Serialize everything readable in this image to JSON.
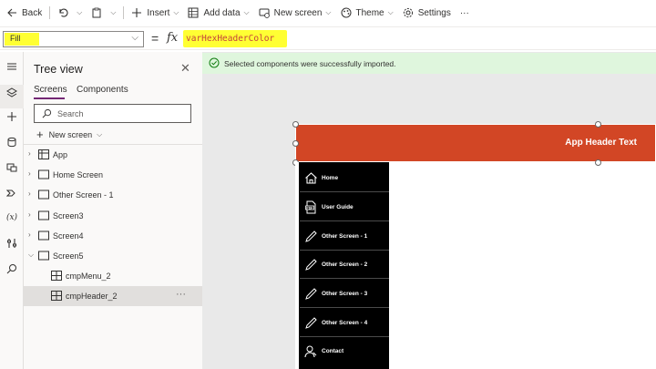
{
  "toolbar": {
    "back_label": "Back",
    "insert_label": "Insert",
    "add_data_label": "Add data",
    "new_screen_label": "New screen",
    "theme_label": "Theme",
    "settings_label": "Settings",
    "more_label": "···"
  },
  "formula_bar": {
    "property": "Fill",
    "equals": "=",
    "fx": "fx",
    "formula": "varHexHeaderColor",
    "highlight_color": "#ffff33"
  },
  "left_rail": {
    "icons": [
      "hamburger-icon",
      "layers-icon",
      "plus-icon",
      "database-icon",
      "media-icon",
      "power-automate-icon",
      "variables-icon",
      "tools-icon",
      "search-icon"
    ],
    "variables_label": "(x)"
  },
  "tree_view": {
    "title": "Tree view",
    "close": "✕",
    "tabs": [
      {
        "label": "Screens",
        "active": true
      },
      {
        "label": "Components",
        "active": false
      }
    ],
    "search_placeholder": "Search",
    "new_screen_label": "New screen",
    "nodes": [
      {
        "label": "App",
        "icon": "app-icon",
        "expanded": false
      },
      {
        "label": "Home Screen",
        "icon": "screen-icon",
        "expanded": false
      },
      {
        "label": "Other Screen - 1",
        "icon": "screen-icon",
        "expanded": false
      },
      {
        "label": "Screen3",
        "icon": "screen-icon",
        "expanded": false
      },
      {
        "label": "Screen4",
        "icon": "screen-icon",
        "expanded": false
      },
      {
        "label": "Screen5",
        "icon": "screen-icon",
        "expanded": true
      },
      {
        "label": "cmpMenu_2",
        "icon": "component-icon",
        "child": true
      },
      {
        "label": "cmpHeader_2",
        "icon": "component-icon",
        "child": true,
        "selected": true
      }
    ],
    "more_label": "···"
  },
  "canvas": {
    "notification": "Selected components were successfully imported.",
    "header_text": "App Header Text",
    "header_color": "#d24625",
    "menu_items": [
      {
        "label": "Home",
        "icon": "home-icon"
      },
      {
        "label": "User Guide",
        "icon": "pdf-icon"
      },
      {
        "label": "Other Screen - 1",
        "icon": "pencil-icon"
      },
      {
        "label": "Other Screen - 2",
        "icon": "pencil-icon"
      },
      {
        "label": "Other Screen - 3",
        "icon": "pencil-icon"
      },
      {
        "label": "Other Screen - 4",
        "icon": "pencil-icon"
      },
      {
        "label": "Contact",
        "icon": "contact-icon"
      }
    ]
  },
  "colors": {
    "accent": "#742774",
    "success_bg": "#dff6dd",
    "canvas_bg": "#e9e9e9"
  }
}
